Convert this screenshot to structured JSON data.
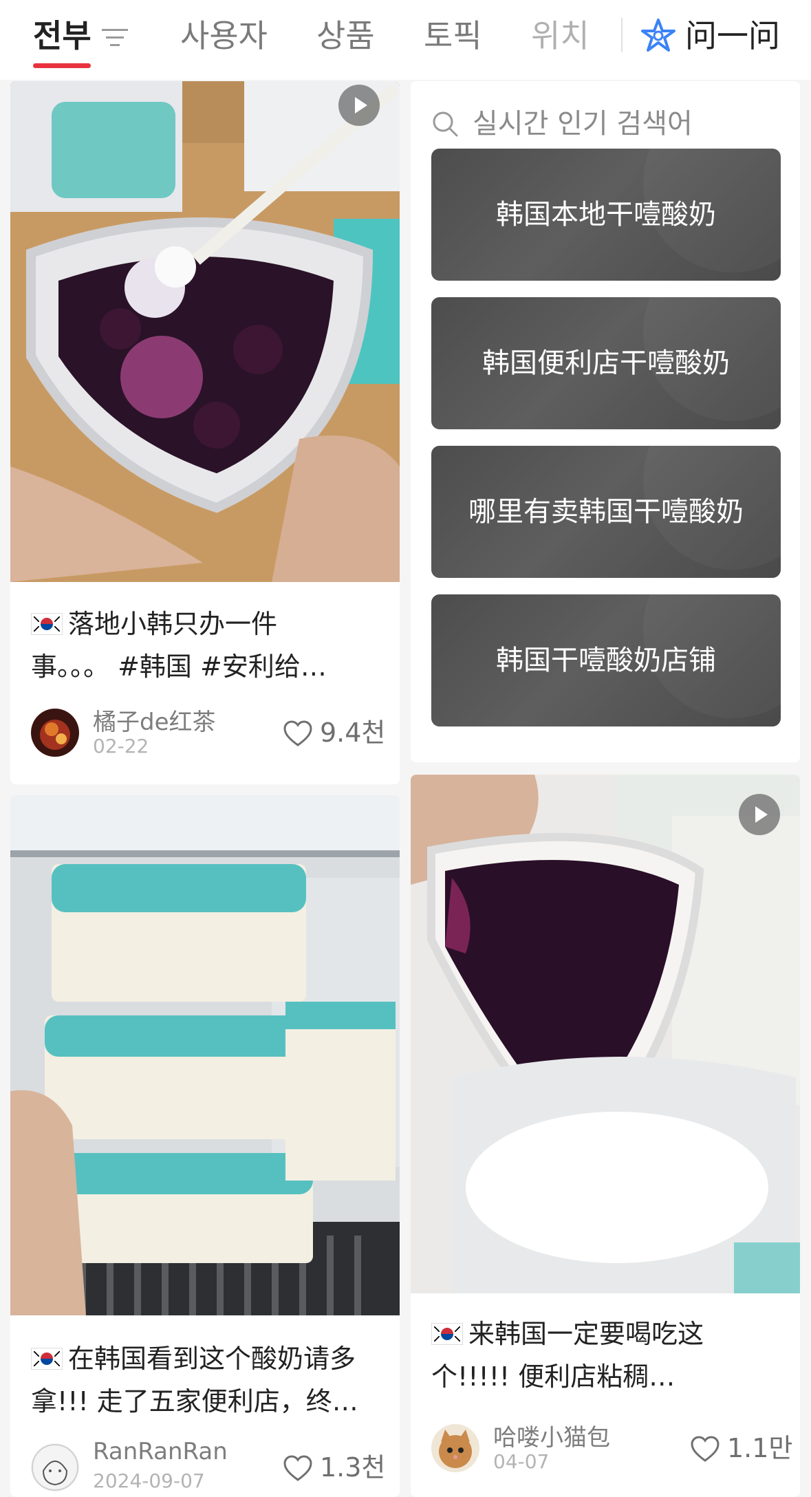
{
  "tabs": [
    {
      "label": "전부",
      "active": true
    },
    {
      "label": "사용자"
    },
    {
      "label": "상품"
    },
    {
      "label": "토픽"
    },
    {
      "label": "위치"
    }
  ],
  "ask_label": "问一问",
  "trending": {
    "title": "실시간 인기 검색어",
    "items": [
      "韩国本地干噎酸奶",
      "韩国便利店干噎酸奶",
      "哪里有卖韩国干噎酸奶",
      "韩国干噎酸奶店铺"
    ]
  },
  "posts": [
    {
      "title_line1": "落地小韩只办一件",
      "title_line2": "事。。。 #韩国 #安利给…",
      "author": "橘子de红茶",
      "date": "02-22",
      "likes": "9.4천",
      "video": true
    },
    {
      "title_line1": "来韩国一定要喝吃这",
      "title_line2": "个!!!!! 便利店粘稠…",
      "author": "哈喽小猫包",
      "date": "04-07",
      "likes": "1.1만",
      "video": true
    },
    {
      "title_line1": "在韩国看到这个酸奶请多",
      "title_line2": "拿!!! 走了五家便利店，终…",
      "author": "RanRanRan",
      "date": "2024-09-07",
      "likes": "1.3천",
      "video": false
    }
  ],
  "colors": {
    "accent": "#e8333f",
    "trend_bg": "#555555",
    "ask_icon": "#3b82f6"
  }
}
